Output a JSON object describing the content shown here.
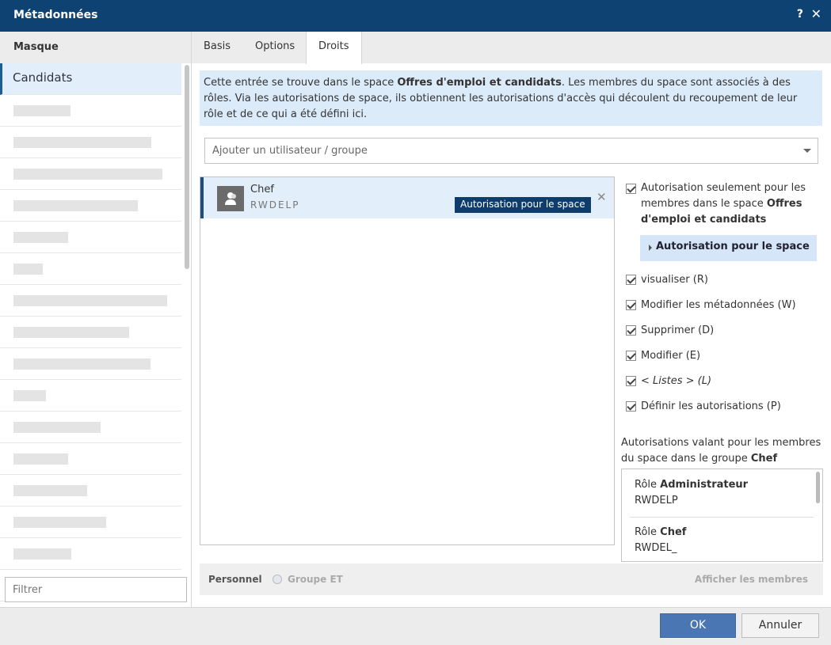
{
  "window": {
    "title": "Métadonnées",
    "help_label": "?",
    "close_label": "✕"
  },
  "sidebar": {
    "header": "Masque",
    "selected_item": "Candidats",
    "filter_placeholder": "Filtrer"
  },
  "tabs": [
    {
      "label": "Basis"
    },
    {
      "label": "Options"
    },
    {
      "label": "Droits"
    }
  ],
  "info": {
    "part1": "Cette entrée se trouve dans le space ",
    "space_name": "Offres d'emploi et candidats",
    "part2": ". Les membres du space sont associés à des rôles. Via les autorisations de space, ils obtiennent les autorisations d'accès qui découlent du recoupement de leur rôle et de ce qui a été défini ici."
  },
  "add_user": {
    "placeholder": "Ajouter un utilisateur / groupe"
  },
  "user_entry": {
    "name": "Chef",
    "rights": "RWDELP",
    "badge": "Autorisation pour le space",
    "remove_label": "✕"
  },
  "permissions": {
    "space_only_text": "Autorisation seulement pour les membres dans le space ",
    "space_only_name": "Offres d'emploi et candidats",
    "expander_label": "Autorisation pour le space",
    "items": [
      {
        "label": "visualiser (R)"
      },
      {
        "label": "Modifier les métadonnées (W)"
      },
      {
        "label": "Supprimer (D)"
      },
      {
        "label": "Modifier (E)"
      },
      {
        "label": "< Listes > (L)"
      },
      {
        "label": "Définir les autorisations (P)"
      }
    ]
  },
  "group_note": {
    "text": "Autorisations valant pour les membres du space dans le groupe ",
    "group": "Chef"
  },
  "roles": [
    {
      "prefix": "Rôle ",
      "name": "Administrateur",
      "rights": "RWDELP"
    },
    {
      "prefix": "Rôle ",
      "name": "Chef",
      "rights": "RWDEL_"
    }
  ],
  "footer": {
    "personal_label": "Personnel",
    "group_label": "Groupe ET",
    "show_members": "Afficher les membres"
  },
  "buttons": {
    "ok": "OK",
    "cancel": "Annuler"
  }
}
